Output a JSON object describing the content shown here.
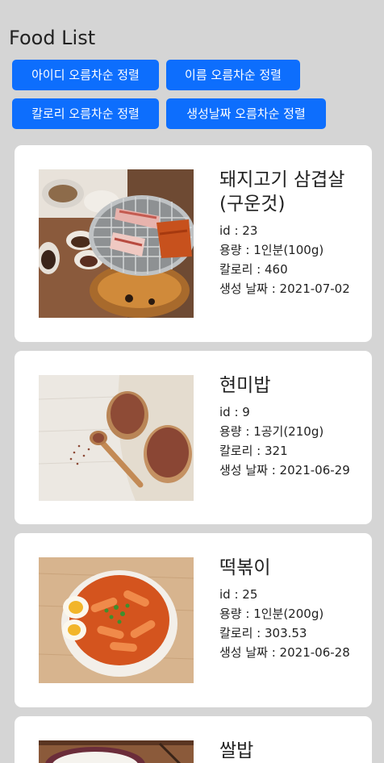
{
  "page": {
    "title": "Food List"
  },
  "sort_buttons": {
    "by_id": "아이디 오름차순 정렬",
    "by_name": "이름 오름차순 정렬",
    "by_calorie": "칼로리 오름차순 정렬",
    "by_date": "생성날짜 오름차순 정렬"
  },
  "colors": {
    "background": "#d5d5d5",
    "button": "#0d6efd",
    "card": "#ffffff"
  },
  "foods": [
    {
      "name": "돼지고기 삼겹살(구운것)",
      "id": "id : 23",
      "amount": "용량 : 1인분(100g)",
      "calorie": "칼로리 : 460",
      "created": "생성 날짜 : 2021-07-02",
      "image": "grilled-pork-belly-photo"
    },
    {
      "name": "현미밥",
      "id": "id : 9",
      "amount": "용량 : 1공기(210g)",
      "calorie": "칼로리 : 321",
      "created": "생성 날짜 : 2021-06-29",
      "image": "brown-rice-photo"
    },
    {
      "name": "떡볶이",
      "id": "id : 25",
      "amount": "용량 : 1인분(200g)",
      "calorie": "칼로리 : 303.53",
      "created": "생성 날짜 : 2021-06-28",
      "image": "tteokbokki-photo"
    },
    {
      "name": "쌀밥",
      "image": "white-rice-photo"
    }
  ]
}
